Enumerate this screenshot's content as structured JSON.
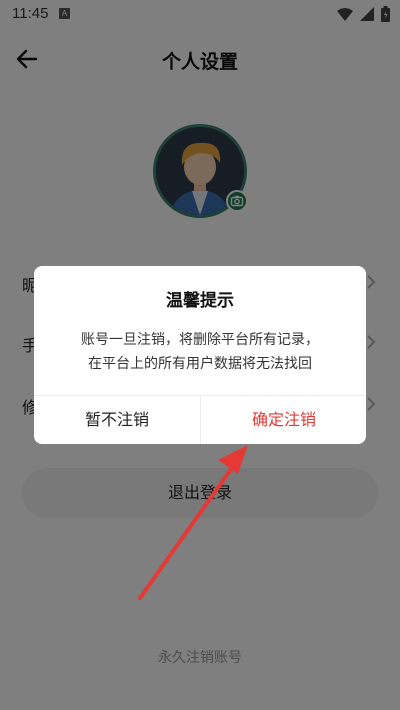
{
  "status_bar": {
    "time": "11:45",
    "badge": "A"
  },
  "header": {
    "title": "个人设置"
  },
  "settings_rows": [
    {
      "label": "昵称"
    },
    {
      "label": "手机号"
    },
    {
      "label": "修改密码"
    }
  ],
  "logout_label": "退出登录",
  "delete_account_label": "永久注销账号",
  "dialog": {
    "title": "温馨提示",
    "message_line1": "账号一旦注销，将删除平台所有记录，",
    "message_line2": "在平台上的所有用户数据将无法找回",
    "cancel_label": "暂不注销",
    "confirm_label": "确定注销"
  },
  "colors": {
    "confirm": "#e53935",
    "annotation_arrow": "#e53935",
    "avatar_ring": "#3e7f72",
    "camera_badge": "#1f7a55"
  },
  "icons": [
    "back-arrow-icon",
    "camera-icon",
    "wifi-icon",
    "signal-icon",
    "battery-icon",
    "chevron-right-icon"
  ]
}
